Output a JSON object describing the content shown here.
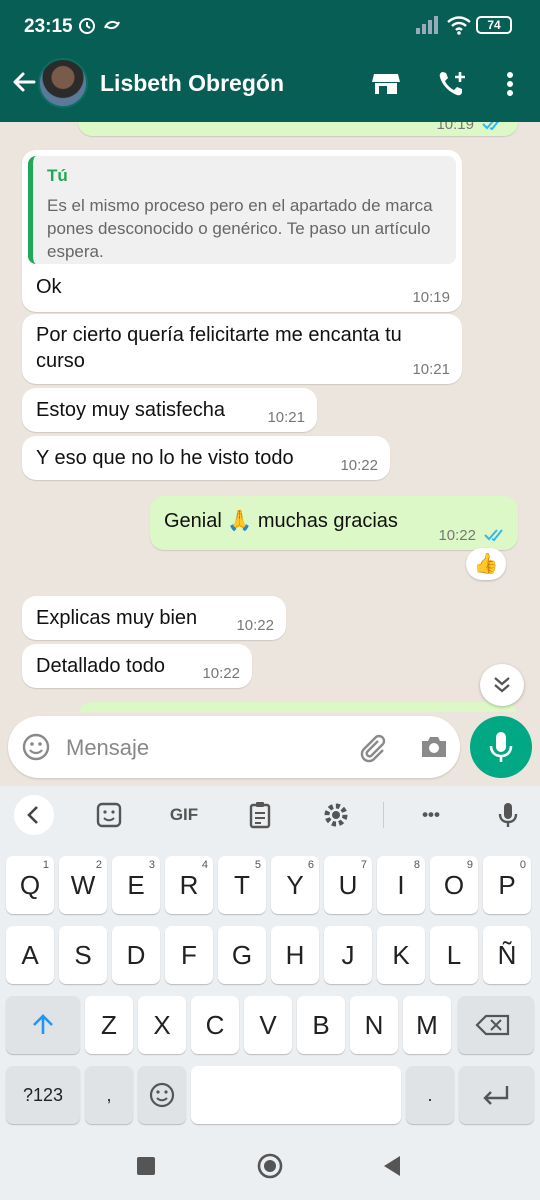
{
  "status": {
    "time": "23:15",
    "battery": "74"
  },
  "header": {
    "contact_name": "Lisbeth Obregón"
  },
  "messages": [
    {
      "id": "m1",
      "quote_author": "Tú",
      "quote_text": "Es el mismo proceso pero en el apartado de marca pones desconocido o genérico. Te paso un artículo espera.",
      "text": "Ok",
      "time": "10:19"
    },
    {
      "id": "m2",
      "text": "Por cierto quería felicitarte me encanta tu curso",
      "time": "10:21"
    },
    {
      "id": "m3",
      "text": "Estoy muy satisfecha",
      "time": "10:21"
    },
    {
      "id": "m4",
      "text": "Y eso que no lo he visto todo",
      "time": "10:22"
    },
    {
      "id": "m5",
      "text_before": "Genial",
      "emoji": "🙏",
      "text_after": "muchas gracias",
      "time": "10:22",
      "reaction": "👍"
    },
    {
      "id": "m6",
      "text": "Explicas muy bien",
      "time": "10:22"
    },
    {
      "id": "m7",
      "text": "Detallado todo",
      "time": "10:22"
    }
  ],
  "top_partial_time": "10:19",
  "input": {
    "placeholder": "Mensaje"
  },
  "keyboard": {
    "toolbar": {
      "gif": "GIF",
      "more": "•••"
    },
    "row1": [
      {
        "k": "Q",
        "n": "1"
      },
      {
        "k": "W",
        "n": "2"
      },
      {
        "k": "E",
        "n": "3"
      },
      {
        "k": "R",
        "n": "4"
      },
      {
        "k": "T",
        "n": "5"
      },
      {
        "k": "Y",
        "n": "6"
      },
      {
        "k": "U",
        "n": "7"
      },
      {
        "k": "I",
        "n": "8"
      },
      {
        "k": "O",
        "n": "9"
      },
      {
        "k": "P",
        "n": "0"
      }
    ],
    "row2": [
      "A",
      "S",
      "D",
      "F",
      "G",
      "H",
      "J",
      "K",
      "L",
      "Ñ"
    ],
    "row3": [
      "Z",
      "X",
      "C",
      "V",
      "B",
      "N",
      "M"
    ],
    "symbols": "?123",
    "comma": ",",
    "period": "."
  },
  "colors": {
    "header": "#075e54",
    "accent": "#00a884",
    "outgoing": "#dcf8c6",
    "read_tick": "#34b7f1"
  }
}
